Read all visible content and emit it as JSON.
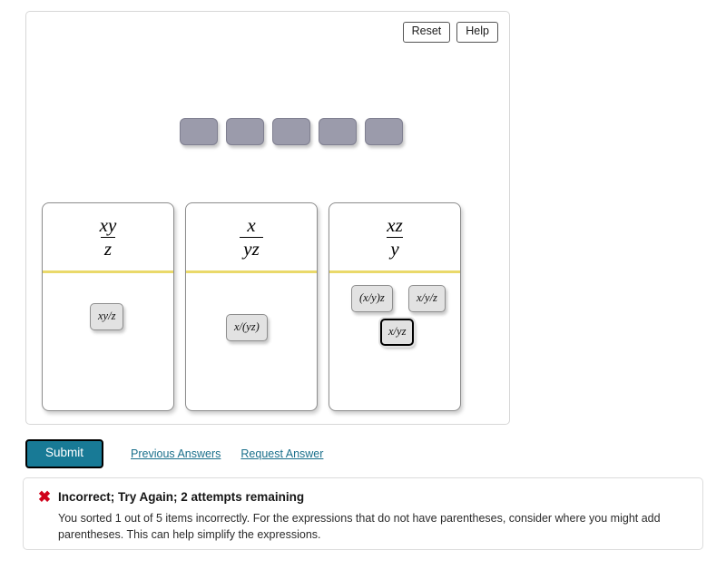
{
  "toolbar": {
    "reset_label": "Reset",
    "help_label": "Help"
  },
  "slots": {
    "count": 5,
    "items": [
      {
        "label": ""
      },
      {
        "label": ""
      },
      {
        "label": ""
      },
      {
        "label": ""
      },
      {
        "label": ""
      }
    ]
  },
  "bins": [
    {
      "header_numerator": "xy",
      "header_denominator": "z",
      "tiles": [
        {
          "label": "xy/z",
          "selected": false
        }
      ]
    },
    {
      "header_numerator": "x",
      "header_denominator": "yz",
      "tiles": [
        {
          "label": "x/(yz)",
          "selected": false
        }
      ]
    },
    {
      "header_numerator": "xz",
      "header_denominator": "y",
      "tiles": [
        {
          "label": "(x/y)z",
          "selected": false
        },
        {
          "label": "x/y/z",
          "selected": false
        },
        {
          "label": "x/yz",
          "selected": true
        }
      ]
    }
  ],
  "actions": {
    "submit_label": "Submit",
    "previous_answers_label": "Previous Answers",
    "request_answer_label": "Request Answer"
  },
  "feedback": {
    "icon": "x-mark-icon",
    "icon_glyph": "✖",
    "heading": "Incorrect; Try Again; 2 attempts remaining",
    "body": "You sorted 1 out of 5 items incorrectly. For the expressions that do not have parentheses, consider where you might add parentheses. This can help simplify the expressions.",
    "accent_color": "#d0021b"
  },
  "colors": {
    "slot_fill": "#9b9bab",
    "divider": "#ead96a",
    "submit_bg": "#187a96",
    "link": "#1a6f8b"
  }
}
